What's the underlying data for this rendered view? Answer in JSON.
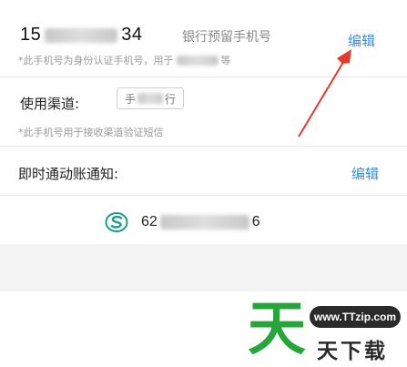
{
  "phone_section": {
    "number_prefix": "15",
    "number_suffix": "34",
    "label": "银行预留手机号",
    "edit_label": "编辑",
    "note_prefix": "*此手机号为身份认证手机号，用于",
    "note_suffix": "等"
  },
  "channel_section": {
    "label": "使用渠道:",
    "value_prefix": "手",
    "value_suffix": "行",
    "note": "*此手机号用于接收渠道验证短信"
  },
  "notify_section": {
    "label": "即时通动账通知:",
    "edit_label": "编辑",
    "account_prefix": "62",
    "account_suffix": "6",
    "bank_icon": "bank-logo-icon"
  },
  "watermark": {
    "url": "www.TTzip.com",
    "big_char": "天",
    "text": "天下载"
  },
  "colors": {
    "accent": "#3a8ed6",
    "arrow": "#e23a2e",
    "brand_green": "#26a63a"
  }
}
